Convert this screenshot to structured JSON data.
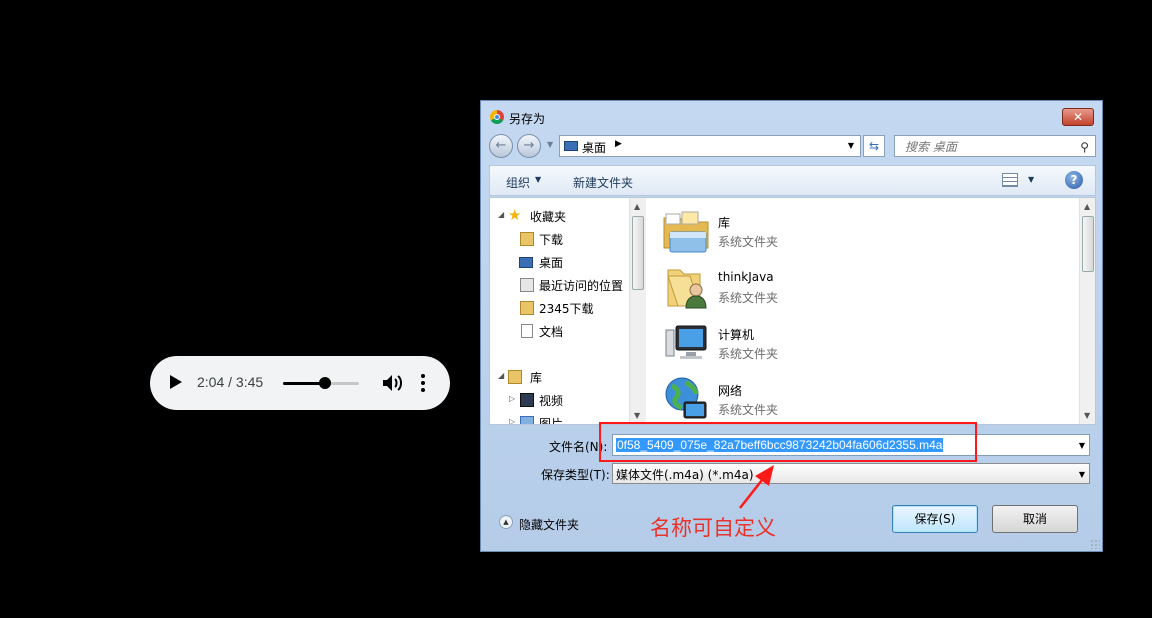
{
  "audio": {
    "time": "2:04 / 3:45",
    "progress_fraction": 0.55
  },
  "dialog": {
    "title": "另存为",
    "close_label": "✕",
    "nav": {
      "back_label": "←",
      "forward_label": "→",
      "location": "桌面",
      "search_placeholder": "搜索 桌面"
    },
    "toolbar": {
      "organize": "组织",
      "new_folder": "新建文件夹",
      "help": "?"
    },
    "tree": [
      {
        "label": "收藏夹",
        "icon": "star-icon"
      },
      {
        "label": "下载",
        "icon": "download-folder-icon"
      },
      {
        "label": "桌面",
        "icon": "desktop-icon"
      },
      {
        "label": "最近访问的位置",
        "icon": "recent-places-icon"
      },
      {
        "label": "2345下载",
        "icon": "folder-icon"
      },
      {
        "label": "文档",
        "icon": "document-icon"
      },
      {
        "label": "库",
        "icon": "library-icon"
      },
      {
        "label": "视频",
        "icon": "video-icon"
      },
      {
        "label": "图片",
        "icon": "picture-icon"
      }
    ],
    "files": [
      {
        "name": "库",
        "type": "系统文件夹",
        "icon": "library-folder-icon"
      },
      {
        "name": "thinkJava",
        "type": "系统文件夹",
        "icon": "user-folder-icon"
      },
      {
        "name": "计算机",
        "type": "系统文件夹",
        "icon": "computer-icon"
      },
      {
        "name": "网络",
        "type": "系统文件夹",
        "icon": "network-icon"
      }
    ],
    "filename_label": "文件名(N):",
    "filename_value": "0f58_5409_075e_82a7beff6bcc9873242b04fa606d2355.m4a",
    "filetype_label": "保存类型(T):",
    "filetype_value": "媒体文件(.m4a) (*.m4a)",
    "hide_folders": "隐藏文件夹",
    "save_button": "保存(S)",
    "cancel_button": "取消"
  },
  "annotation": {
    "text": "名称可自定义",
    "color": "#e8332a"
  }
}
